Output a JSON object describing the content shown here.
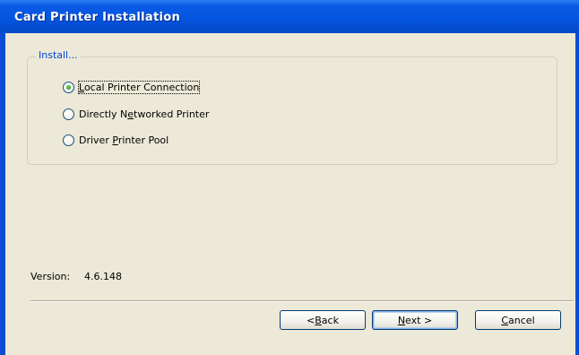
{
  "window": {
    "title": "Card Printer Installation"
  },
  "install_group": {
    "legend": "Install...",
    "options": [
      {
        "pre": "",
        "accel": "L",
        "post": "ocal Printer Connection",
        "checked": true
      },
      {
        "pre": "Directly N",
        "accel": "e",
        "post": "tworked Printer",
        "checked": false
      },
      {
        "pre": "Driver ",
        "accel": "P",
        "post": "rinter Pool",
        "checked": false
      }
    ]
  },
  "version": {
    "label": "Version:",
    "value": "4.6.148"
  },
  "buttons": {
    "back": {
      "pre": "< ",
      "accel": "B",
      "post": "ack"
    },
    "next": {
      "pre": "",
      "accel": "N",
      "post": "ext >"
    },
    "cancel": {
      "pre": "",
      "accel": "C",
      "post": "ancel"
    }
  }
}
